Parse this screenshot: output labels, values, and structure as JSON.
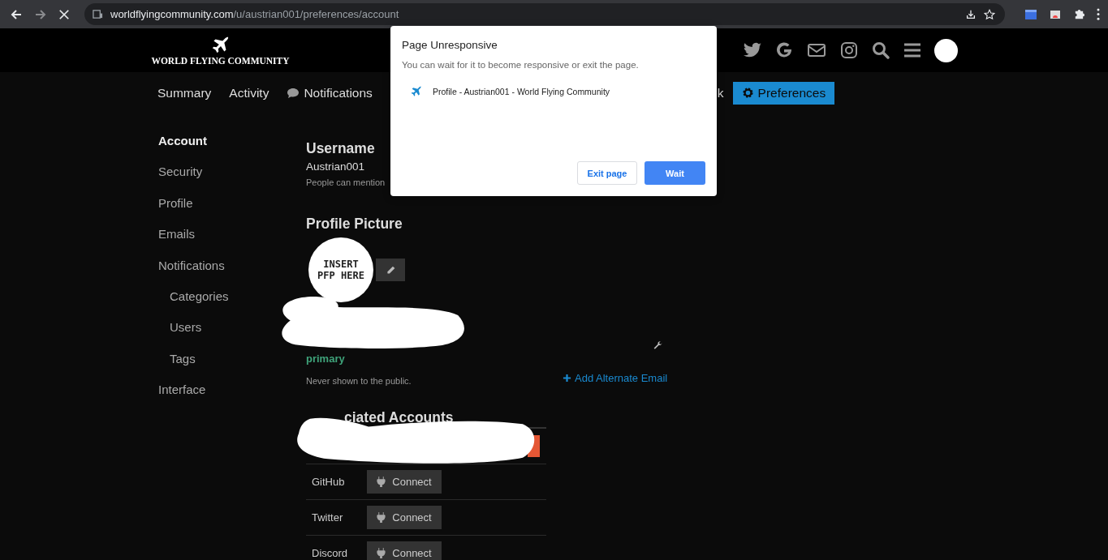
{
  "browser": {
    "url_host": "worldflyingcommunity.com",
    "url_path": "/u/austrian001/preferences/account"
  },
  "header": {
    "logo_text": "WORLD FLYING COMMUNITY"
  },
  "nav": [
    {
      "label": "Summary",
      "kind": "text",
      "selected": false
    },
    {
      "label": "Activity",
      "kind": "text",
      "selected": false
    },
    {
      "label": "Notifications",
      "kind": "chat",
      "selected": false
    },
    {
      "label": "k",
      "kind": "text",
      "selected": false
    },
    {
      "label": "Preferences",
      "kind": "gear",
      "selected": true
    }
  ],
  "sidebar": {
    "items": [
      {
        "label": "Account",
        "selected": true
      },
      {
        "label": "Security",
        "selected": false
      },
      {
        "label": "Profile",
        "selected": false
      },
      {
        "label": "Emails",
        "selected": false
      },
      {
        "label": "Notifications",
        "selected": false,
        "children": [
          {
            "label": "Categories",
            "selected": false
          },
          {
            "label": "Users",
            "selected": false
          },
          {
            "label": "Tags",
            "selected": false
          }
        ]
      },
      {
        "label": "Interface",
        "selected": false
      }
    ]
  },
  "username": {
    "heading": "Username",
    "value": "Austrian001",
    "description": "People can mention"
  },
  "profile_picture": {
    "heading": "Profile Picture",
    "avatar_text": "INSERT PFP HERE"
  },
  "email": {
    "badge": "primary",
    "note": "Never shown to the public.",
    "add_link": "Add Alternate Email"
  },
  "associated_accounts": {
    "heading": "ciated Accounts",
    "rows": [
      {
        "name": "GitHub",
        "button": "Connect"
      },
      {
        "name": "Twitter",
        "button": "Connect"
      },
      {
        "name": "Discord",
        "button": "Connect"
      }
    ]
  },
  "dialog": {
    "title": "Page Unresponsive",
    "message": "You can wait for it to become responsive or exit the page.",
    "page_title": "Profile - Austrian001 - World Flying Community",
    "buttons": [
      {
        "label": "Exit page",
        "kind": "secondary"
      },
      {
        "label": "Wait",
        "kind": "primary"
      }
    ]
  }
}
